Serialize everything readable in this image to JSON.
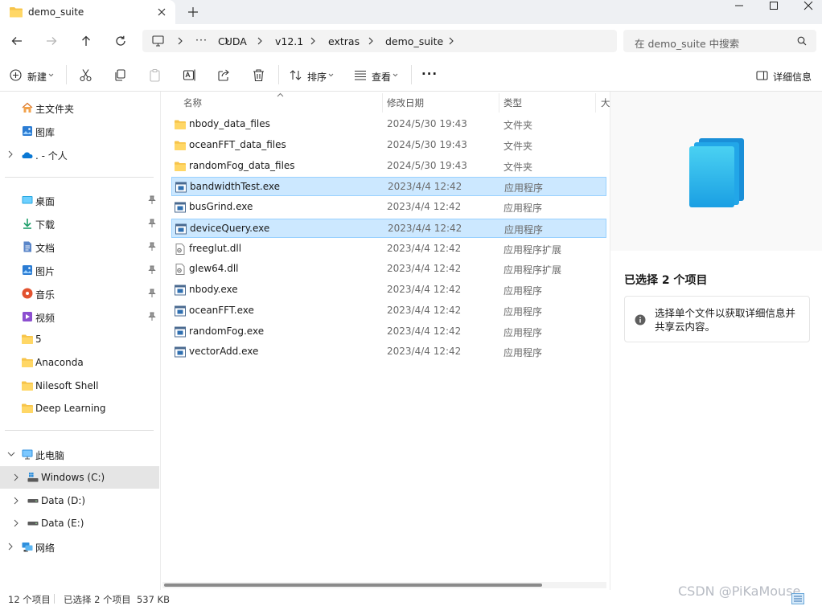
{
  "window": {
    "tab_title": "demo_suite"
  },
  "address": {
    "crumbs": [
      "CUDA",
      "v12.1",
      "extras",
      "demo_suite"
    ],
    "ellipsis": "···",
    "search_placeholder": "在 demo_suite 中搜索"
  },
  "toolbar": {
    "new_label": "新建",
    "sort_label": "排序",
    "view_label": "查看",
    "more_label": "···",
    "details_label": "详细信息"
  },
  "sidebar": {
    "quick": [
      {
        "label": "主文件夹",
        "icon": "home-icon"
      },
      {
        "label": "图库",
        "icon": "gallery-icon"
      },
      {
        "label": ". - 个人",
        "icon": "onedrive-icon"
      }
    ],
    "pinned": [
      {
        "label": "桌面",
        "icon": "desktop-icon"
      },
      {
        "label": "下载",
        "icon": "download-icon"
      },
      {
        "label": "文档",
        "icon": "documents-icon"
      },
      {
        "label": "图片",
        "icon": "pictures-icon"
      },
      {
        "label": "音乐",
        "icon": "music-icon"
      },
      {
        "label": "视频",
        "icon": "videos-icon"
      },
      {
        "label": "5",
        "icon": "folder-icon"
      },
      {
        "label": "Anaconda",
        "icon": "folder-icon"
      },
      {
        "label": "Nilesoft Shell",
        "icon": "folder-icon"
      },
      {
        "label": "Deep Learning",
        "icon": "folder-icon"
      }
    ],
    "thispc": {
      "label": "此电脑"
    },
    "drives": [
      {
        "label": "Windows (C:)"
      },
      {
        "label": "Data (D:)"
      },
      {
        "label": "Data (E:)"
      }
    ],
    "network": {
      "label": "网络"
    }
  },
  "filelist": {
    "columns": {
      "name": "名称",
      "date": "修改日期",
      "type": "类型",
      "size": "大"
    },
    "files": [
      {
        "name": "nbody_data_files",
        "date": "2024/5/30 19:43",
        "type": "文件夹",
        "kind": "folder",
        "selected": false
      },
      {
        "name": "oceanFFT_data_files",
        "date": "2024/5/30 19:43",
        "type": "文件夹",
        "kind": "folder",
        "selected": false
      },
      {
        "name": "randomFog_data_files",
        "date": "2024/5/30 19:43",
        "type": "文件夹",
        "kind": "folder",
        "selected": false
      },
      {
        "name": "bandwidthTest.exe",
        "date": "2023/4/4 12:42",
        "type": "应用程序",
        "kind": "exe",
        "selected": true
      },
      {
        "name": "busGrind.exe",
        "date": "2023/4/4 12:42",
        "type": "应用程序",
        "kind": "exe",
        "selected": false
      },
      {
        "name": "deviceQuery.exe",
        "date": "2023/4/4 12:42",
        "type": "应用程序",
        "kind": "exe",
        "selected": true
      },
      {
        "name": "freeglut.dll",
        "date": "2023/4/4 12:42",
        "type": "应用程序扩展",
        "kind": "dll",
        "selected": false
      },
      {
        "name": "glew64.dll",
        "date": "2023/4/4 12:42",
        "type": "应用程序扩展",
        "kind": "dll",
        "selected": false
      },
      {
        "name": "nbody.exe",
        "date": "2023/4/4 12:42",
        "type": "应用程序",
        "kind": "exe",
        "selected": false
      },
      {
        "name": "oceanFFT.exe",
        "date": "2023/4/4 12:42",
        "type": "应用程序",
        "kind": "exe",
        "selected": false
      },
      {
        "name": "randomFog.exe",
        "date": "2023/4/4 12:42",
        "type": "应用程序",
        "kind": "exe",
        "selected": false
      },
      {
        "name": "vectorAdd.exe",
        "date": "2023/4/4 12:42",
        "type": "应用程序",
        "kind": "exe",
        "selected": false
      }
    ]
  },
  "details": {
    "title": "已选择 2 个项目",
    "info": "选择单个文件以获取详细信息并共享云内容。"
  },
  "status": {
    "count": "12 个项目",
    "selected": "已选择 2 个项目  537 KB",
    "watermark": "CSDN @PiKaMouse"
  },
  "colors": {
    "accent": "#0067c0",
    "selection": "#cce8ff",
    "selection_border": "#99d1ff",
    "folder": "#f7c44a"
  }
}
